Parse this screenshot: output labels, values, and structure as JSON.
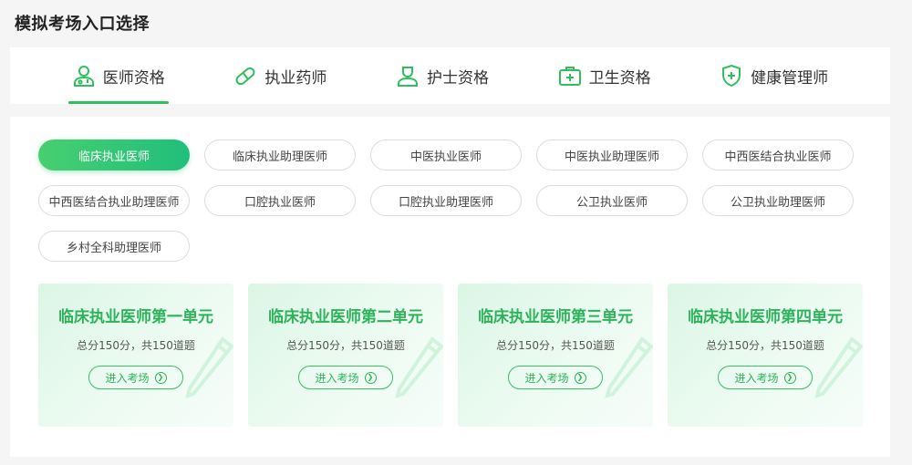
{
  "page_title": "模拟考场入口选择",
  "tabs": [
    {
      "label": "医师资格",
      "icon": "doctor-icon",
      "active": true
    },
    {
      "label": "执业药师",
      "icon": "pill-icon",
      "active": false
    },
    {
      "label": "护士资格",
      "icon": "nurse-icon",
      "active": false
    },
    {
      "label": "卫生资格",
      "icon": "medical-kit-icon",
      "active": false
    },
    {
      "label": "健康管理师",
      "icon": "shield-plus-icon",
      "active": false
    }
  ],
  "exam_types": [
    {
      "label": "临床执业医师",
      "active": true
    },
    {
      "label": "临床执业助理医师",
      "active": false
    },
    {
      "label": "中医执业医师",
      "active": false
    },
    {
      "label": "中医执业助理医师",
      "active": false
    },
    {
      "label": "中西医结合执业医师",
      "active": false
    },
    {
      "label": "中西医结合执业助理医师",
      "active": false
    },
    {
      "label": "口腔执业医师",
      "active": false
    },
    {
      "label": "口腔执业助理医师",
      "active": false
    },
    {
      "label": "公卫执业医师",
      "active": false
    },
    {
      "label": "公卫执业助理医师",
      "active": false
    },
    {
      "label": "乡村全科助理医师",
      "active": false
    }
  ],
  "units": [
    {
      "title": "临床执业医师第一单元",
      "info": "总分150分，共150道题",
      "button": "进入考场"
    },
    {
      "title": "临床执业医师第二单元",
      "info": "总分150分，共150道题",
      "button": "进入考场"
    },
    {
      "title": "临床执业医师第三单元",
      "info": "总分150分，共150道题",
      "button": "进入考场"
    },
    {
      "title": "临床执业医师第四单元",
      "info": "总分150分，共150道题",
      "button": "进入考场"
    }
  ],
  "colors": {
    "accent": "#2fbf5d",
    "card_bg": "#e6f8ee"
  }
}
